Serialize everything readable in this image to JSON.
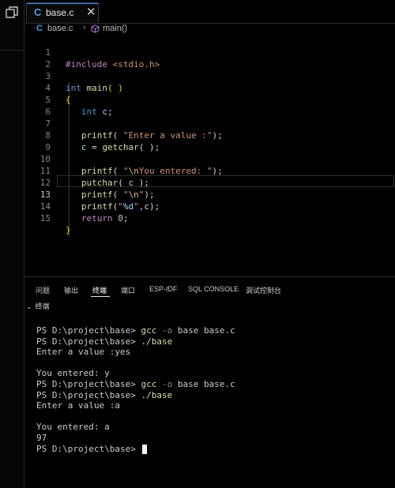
{
  "activity_bar": {
    "icon": "restore-window-icon"
  },
  "tab": {
    "lang_icon": "C",
    "name": "base.c",
    "close": "✕",
    "accent": "#3794ff"
  },
  "breadcrumb": {
    "lang_icon": "C",
    "file": "base.c",
    "separator": "›",
    "symbol": "main()"
  },
  "code_lines": [
    {
      "num": "1",
      "text": "#include <stdio.h>"
    },
    {
      "num": "2",
      "text": ""
    },
    {
      "num": "3",
      "text": "int main( )"
    },
    {
      "num": "4",
      "text": "{"
    },
    {
      "num": "5",
      "text": "    int c;"
    },
    {
      "num": "6",
      "text": ""
    },
    {
      "num": "7",
      "text": "    printf( \"Enter a value :\");"
    },
    {
      "num": "8",
      "text": "    c = getchar( );"
    },
    {
      "num": "9",
      "text": ""
    },
    {
      "num": "10",
      "text": "    printf( \"\\nYou entered: \");"
    },
    {
      "num": "11",
      "text": "    putchar( c );"
    },
    {
      "num": "12",
      "text": "    printf( \"\\n\");"
    },
    {
      "num": "13",
      "text": "    printf(\"%d\",c);"
    },
    {
      "num": "14",
      "text": "    return 0;"
    },
    {
      "num": "15",
      "text": "}"
    }
  ],
  "active_line": "13",
  "panel": {
    "tabs": [
      "问题",
      "输出",
      "终端",
      "端口",
      "ESP-IDF",
      "SQL CONSOLE",
      "调试控制台"
    ],
    "active_tab": "终端",
    "terminal_header": "终端"
  },
  "terminal": {
    "prompt": "PS D:\\project\\base> ",
    "lines": [
      "PS D:\\project\\base> gcc -o base base.c",
      "PS D:\\project\\base> ./base",
      "Enter a value :yes",
      "",
      "You entered: y",
      "PS D:\\project\\base> gcc -o base base.c",
      "PS D:\\project\\base> ./base",
      "Enter a value :a",
      "",
      "You entered: a",
      "97",
      "PS D:\\project\\base> "
    ]
  },
  "colors": {
    "keyword": "#569cd6",
    "function": "#dcdcaa",
    "string": "#ce9178",
    "number": "#b5cea8",
    "preprocessor": "#c586c0",
    "bracket": "#ffd700"
  }
}
